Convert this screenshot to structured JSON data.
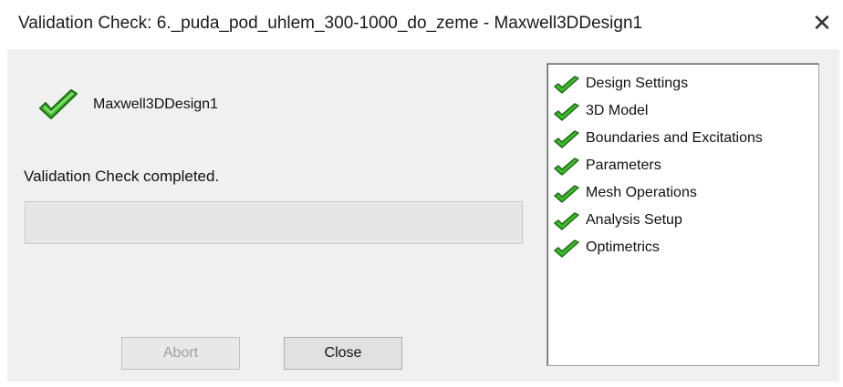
{
  "window": {
    "title": "Validation Check: 6._puda_pod_uhlem_300-1000_do_zeme - Maxwell3DDesign1",
    "close_glyph": "✕"
  },
  "design": {
    "name": "Maxwell3DDesign1",
    "status_icon": "check-icon"
  },
  "status": {
    "text": "Validation Check completed.",
    "progress": 0
  },
  "buttons": {
    "abort_label": "Abort",
    "close_label": "Close"
  },
  "checks": {
    "items": [
      {
        "label": "Design Settings",
        "icon": "check-icon"
      },
      {
        "label": "3D Model",
        "icon": "check-icon"
      },
      {
        "label": "Boundaries and Excitations",
        "icon": "check-icon"
      },
      {
        "label": "Parameters",
        "icon": "check-icon"
      },
      {
        "label": "Mesh Operations",
        "icon": "check-icon"
      },
      {
        "label": "Analysis Setup",
        "icon": "check-icon"
      },
      {
        "label": "Optimetrics",
        "icon": "check-icon"
      }
    ]
  },
  "colors": {
    "check_green": "#3dbb2a",
    "check_outline": "#1e6d16"
  }
}
